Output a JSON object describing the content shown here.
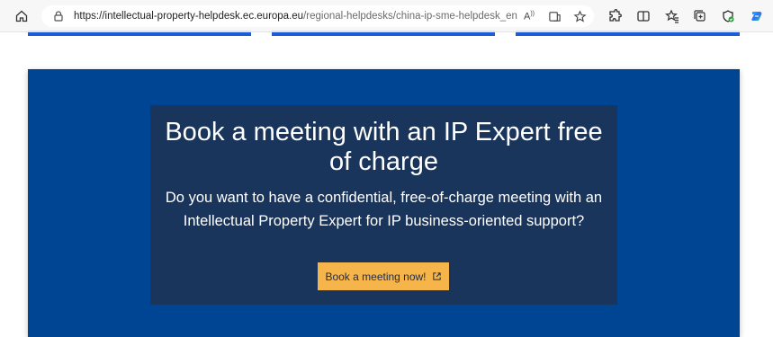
{
  "browser": {
    "url_host": "https://intellectual-property-helpdesk.ec.europa.eu",
    "url_path": "/regional-helpdesks/china-ip-sme-helpdesk_en",
    "read_aloud_label": "A⁾"
  },
  "banner": {
    "title": "Book a meeting with an IP Expert free of charge",
    "text": "Do you want to have a confidential, free-of-charge meeting with an Intellectual Property Expert for IP business-oriented support?",
    "button_label": "Book a meeting now!"
  },
  "colors": {
    "banner_bg": "#004494",
    "box_bg": "#19355c",
    "button_bg": "#f6b54a",
    "card_accent": "#1e5bd6"
  },
  "icons": [
    "home-icon",
    "lock-icon",
    "read-aloud-icon",
    "immersive-reader-icon",
    "favorite-star-icon",
    "extensions-icon",
    "split-screen-icon",
    "favorites-icon",
    "collections-icon",
    "browser-essentials-icon",
    "copilot-icon",
    "external-link-icon"
  ]
}
